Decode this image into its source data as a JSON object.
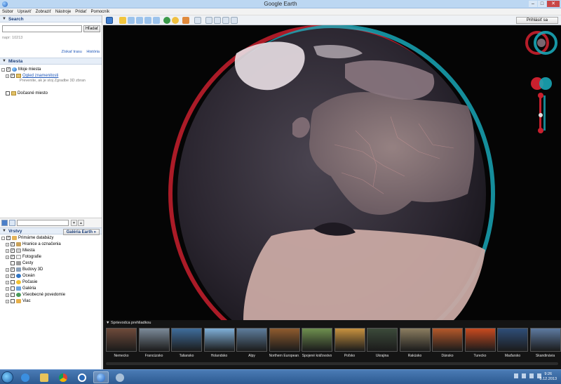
{
  "window": {
    "title": "Google Earth"
  },
  "menu": [
    "Súbor",
    "Upraviť",
    "Zobraziť",
    "Nástroje",
    "Pridať",
    "Pomocník"
  ],
  "search": {
    "header": "Search",
    "button": "Hľadať",
    "hint": "napr: 10213",
    "link_route": "Získať trasu",
    "link_history": "História"
  },
  "places": {
    "header": "Miesta",
    "my_places": "Moje miesta",
    "sightseeing": "Ogled znamenitosti",
    "sightseeing_hint": "Prevenite, ak je stoj Zgradbe 3D zbran",
    "temp_places": "Dočasné miesto"
  },
  "layers": {
    "header": "Vrstvy",
    "gallery_button": "Galéria Earth »",
    "items": [
      "Primárne databázy",
      "Hranice a označenia",
      "Miesta",
      "Fotografie",
      "Cesty",
      "Budovy 3D",
      "Oceán",
      "Počasie",
      "Galéria",
      "Všeobecné povedomie",
      "Viac"
    ]
  },
  "toolbar": {
    "signin": "Prihlásiť sa"
  },
  "tour": {
    "header": "Sprievodca prehliadkou",
    "thumbs": [
      {
        "label": "Nemecko",
        "color": "#6e4a3a"
      },
      {
        "label": "Francúzsko",
        "color": "#7b8a99"
      },
      {
        "label": "Taliansko",
        "color": "#3f6d9c"
      },
      {
        "label": "Holandsko",
        "color": "#7fb0d9"
      },
      {
        "label": "Alpy",
        "color": "#5e7d9c"
      },
      {
        "label": "Northern European ...",
        "color": "#8f5b2e"
      },
      {
        "label": "Spojené kráľovstvo",
        "color": "#6e8f4f"
      },
      {
        "label": "Poľsko",
        "color": "#c8923f"
      },
      {
        "label": "Ukrajina",
        "color": "#3c4a3a"
      },
      {
        "label": "Rakúsko",
        "color": "#8b7d60"
      },
      {
        "label": "Dánsko",
        "color": "#b5582a"
      },
      {
        "label": "Turecko",
        "color": "#c94a1f"
      },
      {
        "label": "Maďarsko",
        "color": "#2f4e78"
      },
      {
        "label": "Škandinávia",
        "color": "#5d7aa1"
      }
    ]
  },
  "clock": {
    "time": "9:26",
    "date": "8.12.2013"
  }
}
